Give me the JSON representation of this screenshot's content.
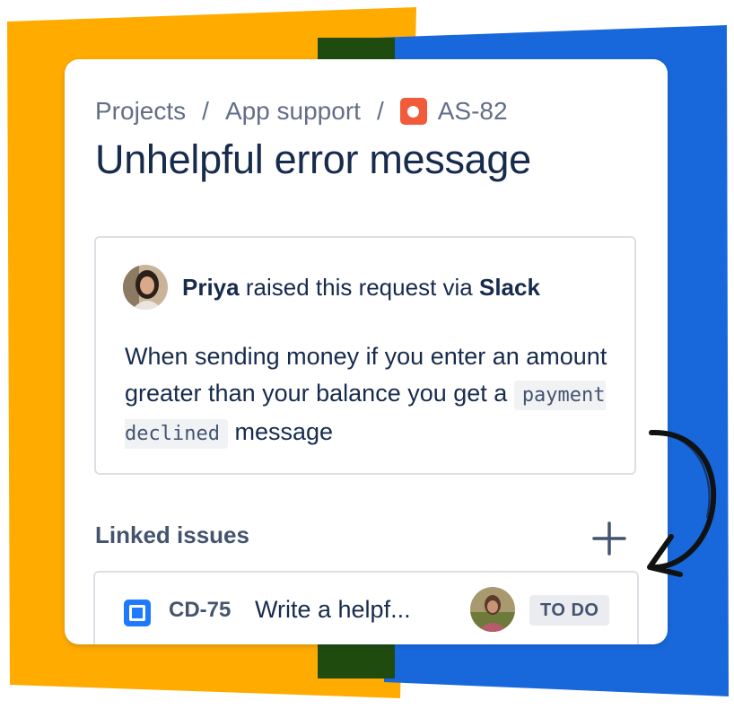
{
  "breadcrumb": {
    "projects": "Projects",
    "separator": "/",
    "project": "App support",
    "issue_key": "AS-82",
    "issue_icon": "issue-type-icon"
  },
  "issue": {
    "title": "Unhelpful error message"
  },
  "request": {
    "requester": "Priya",
    "raised_text": "raised this request via",
    "channel": "Slack",
    "body_before": "When sending money if you enter an amount greater than your balance you get a",
    "body_code": "payment declined",
    "body_after": "message"
  },
  "linked": {
    "heading": "Linked issues",
    "add_icon": "plus-icon",
    "items": [
      {
        "key": "CD-75",
        "summary": "Write a helpf...",
        "status": "TO DO",
        "type_icon": "task-icon"
      }
    ]
  },
  "colors": {
    "orange": "#FFAB00",
    "blue": "#1868DB",
    "green": "#1F4B0F",
    "issue_red": "#F15B3A",
    "task_blue": "#1D7AFC",
    "text_primary": "#172B4D",
    "text_subtle": "#626F86"
  }
}
